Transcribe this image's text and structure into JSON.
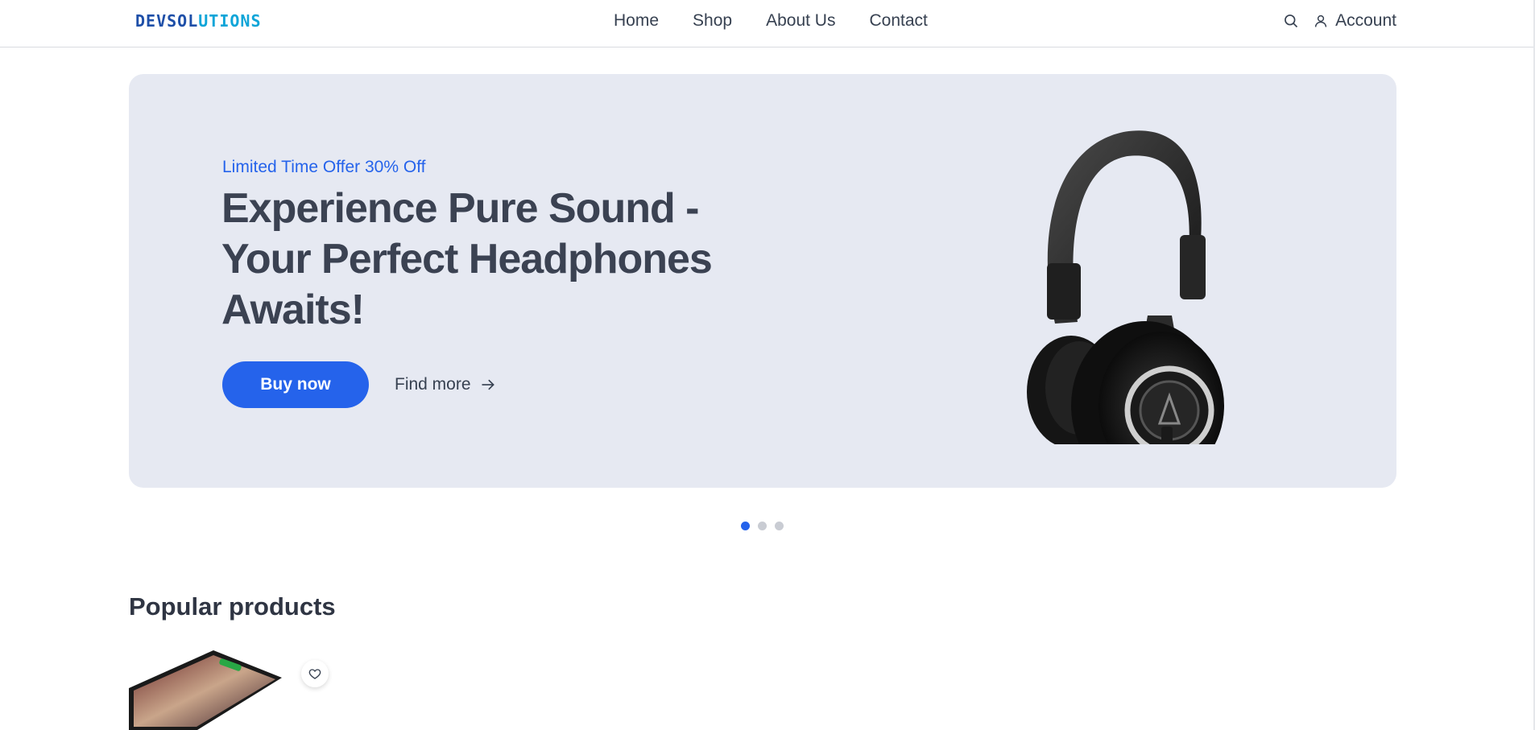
{
  "brand": {
    "logo_part1": "DEVSOL",
    "logo_part2": "UTIONS"
  },
  "nav": {
    "items": [
      {
        "label": "Home"
      },
      {
        "label": "Shop"
      },
      {
        "label": "About Us"
      },
      {
        "label": "Contact"
      }
    ]
  },
  "tools": {
    "search_icon": "search-icon",
    "account_label": "Account"
  },
  "hero": {
    "offer": "Limited Time Offer 30% Off",
    "title": "Experience Pure Sound - Your Perfect Headphones Awaits!",
    "buy_label": "Buy now",
    "find_more_label": "Find more",
    "accent": "#2563eb",
    "background": "#e6e9f2",
    "slides": {
      "count": 3,
      "active": 1
    }
  },
  "popular": {
    "title": "Popular products"
  }
}
